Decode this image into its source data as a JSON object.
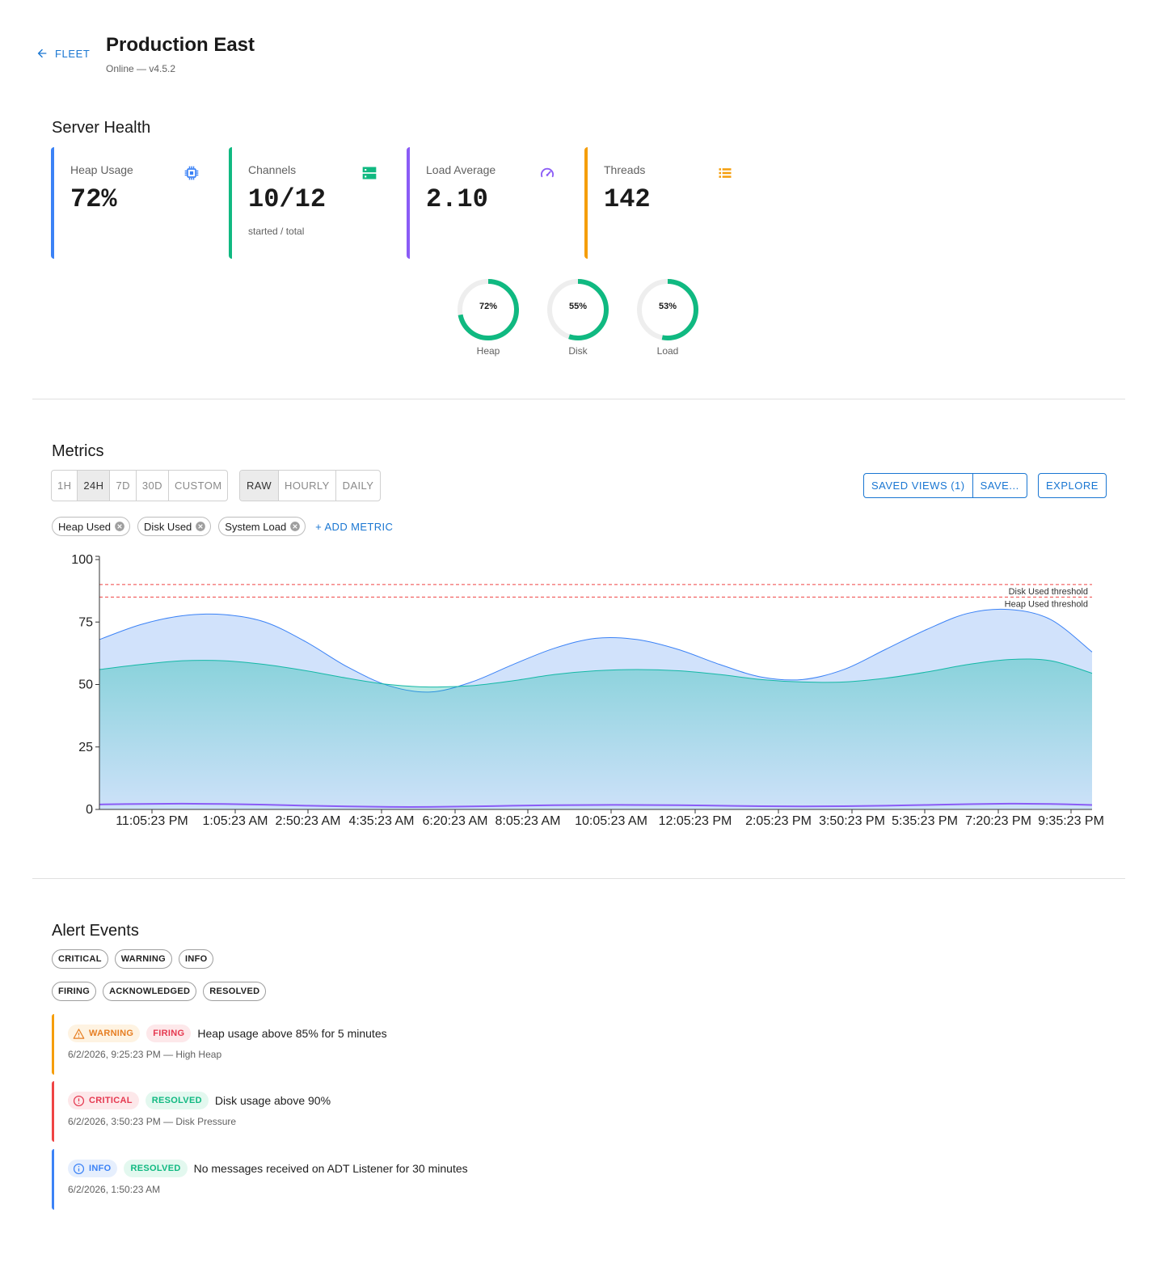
{
  "header": {
    "back_label": "FLEET",
    "title": "Production East",
    "subtitle": "Online — v4.5.2"
  },
  "server_health": {
    "title": "Server Health",
    "cards": [
      {
        "label": "Heap Usage",
        "value": "72%",
        "sub": "",
        "color": "#3b82f6",
        "icon": "cpu-chip-icon"
      },
      {
        "label": "Channels",
        "value": "10/12",
        "sub": "started / total",
        "color": "#10b981",
        "icon": "server-icon"
      },
      {
        "label": "Load Average",
        "value": "2.10",
        "sub": "",
        "color": "#8b5cf6",
        "icon": "speedometer-icon"
      },
      {
        "label": "Threads",
        "value": "142",
        "sub": "",
        "color": "#f59e0b",
        "icon": "list-icon"
      }
    ],
    "gauges": [
      {
        "label": "Heap",
        "percent_text": "72%",
        "value": 72
      },
      {
        "label": "Disk",
        "percent_text": "55%",
        "value": 55
      },
      {
        "label": "Load",
        "percent_text": "53%",
        "value": 53
      }
    ],
    "gauge_color": "#10b981"
  },
  "metrics": {
    "title": "Metrics",
    "ranges": [
      "1H",
      "24H",
      "7D",
      "30D",
      "CUSTOM"
    ],
    "selected_range": "24H",
    "resolutions": [
      "RAW",
      "HOURLY",
      "DAILY"
    ],
    "selected_resolution": "RAW",
    "saved_views_label": "SAVED VIEWS (1)",
    "save_label": "SAVE...",
    "explore_label": "EXPLORE",
    "metric_chips": [
      "Heap Used",
      "Disk Used",
      "System Load"
    ],
    "add_metric_label": "+ ADD METRIC"
  },
  "chart_data": {
    "type": "area",
    "ylim": [
      0,
      100
    ],
    "yticks": [
      0,
      25,
      50,
      75,
      100
    ],
    "xtick_labels": [
      "11:05:23 PM",
      "1:05:23 AM",
      "2:50:23 AM",
      "4:35:23 AM",
      "6:20:23 AM",
      "8:05:23 AM",
      "10:05:23 AM",
      "12:05:23 PM",
      "2:05:23 PM",
      "3:50:23 PM",
      "5:35:23 PM",
      "7:20:23 PM",
      "9:35:23 PM"
    ],
    "x": [
      "10:05:23 PM",
      "11:05:23 PM",
      "12:05:23 AM",
      "1:05:23 AM",
      "2:05:23 AM",
      "3:05:23 AM",
      "4:05:23 AM",
      "5:05:23 AM",
      "6:05:23 AM",
      "7:05:23 AM",
      "8:05:23 AM",
      "9:05:23 AM",
      "10:05:23 AM",
      "11:05:23 AM",
      "12:05:23 PM",
      "1:05:23 PM",
      "2:05:23 PM",
      "3:05:23 PM",
      "4:05:23 PM",
      "5:05:23 PM",
      "6:05:23 PM",
      "7:05:23 PM",
      "8:05:23 PM",
      "9:05:23 PM",
      "10:05:23 PM"
    ],
    "series": [
      {
        "name": "Heap Used",
        "color": "#3b82f6",
        "fill": "#cfe0fb",
        "values": [
          68,
          74,
          77.5,
          78,
          75,
          67,
          57,
          49.5,
          47,
          51,
          58,
          64.5,
          68.5,
          68,
          64,
          58,
          53,
          52,
          56,
          64,
          72,
          78.5,
          80,
          76,
          63
        ]
      },
      {
        "name": "Disk Used",
        "color": "#14b8a6",
        "fill": "#14b8a6",
        "values": [
          56,
          58,
          59.5,
          59.5,
          58,
          55.5,
          52.5,
          50,
          49,
          49.5,
          51.5,
          54,
          55.5,
          56,
          55.5,
          54,
          52,
          51,
          51,
          52.5,
          55,
          58,
          60,
          59.5,
          54.5
        ]
      },
      {
        "name": "System Load",
        "color": "#8b5cf6",
        "fill": "none",
        "values": [
          2,
          2.2,
          2.3,
          2.2,
          1.9,
          1.5,
          1.2,
          1.0,
          1.0,
          1.2,
          1.5,
          1.7,
          1.8,
          1.8,
          1.7,
          1.5,
          1.3,
          1.2,
          1.3,
          1.5,
          1.8,
          2.1,
          2.3,
          2.2,
          1.8
        ]
      }
    ],
    "thresholds": [
      {
        "label": "Disk Used threshold",
        "value": 90,
        "color": "#ef4444"
      },
      {
        "label": "Heap Used threshold",
        "value": 85,
        "color": "#ef4444"
      }
    ]
  },
  "alerts": {
    "title": "Alert Events",
    "severity_filters": [
      "CRITICAL",
      "WARNING",
      "INFO"
    ],
    "state_filters": [
      "FIRING",
      "ACKNOWLEDGED",
      "RESOLVED"
    ],
    "items": [
      {
        "severity": "WARNING",
        "state": "FIRING",
        "message": "Heap usage above 85% for 5 minutes",
        "meta": "6/2/2026, 9:25:23 PM — High Heap",
        "border": "#f59e0b"
      },
      {
        "severity": "CRITICAL",
        "state": "RESOLVED",
        "message": "Disk usage above 90%",
        "meta": "6/2/2026, 3:50:23 PM — Disk Pressure",
        "border": "#ef4444"
      },
      {
        "severity": "INFO",
        "state": "RESOLVED",
        "message": "No messages received on ADT Listener for 30 minutes",
        "meta": "6/2/2026, 1:50:23 AM",
        "border": "#3b82f6"
      }
    ]
  }
}
